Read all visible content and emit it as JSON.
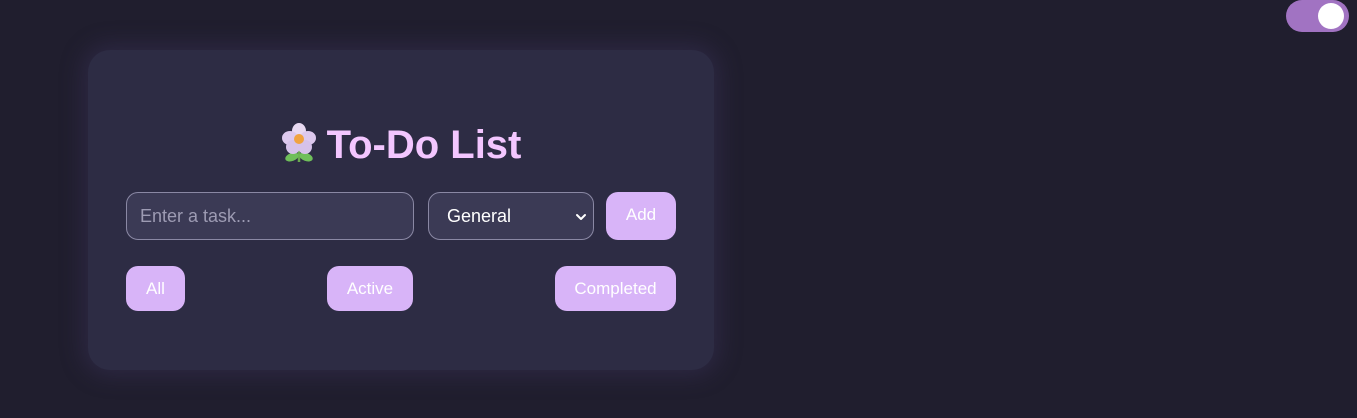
{
  "theme_toggle": {
    "state": "on",
    "color": "#a173c2"
  },
  "todo": {
    "title": "To-Do List",
    "title_icon": "flower-icon",
    "task_input": {
      "placeholder": "Enter a task...",
      "value": ""
    },
    "category_select": {
      "selected": "General"
    },
    "add_label": "Add",
    "filters": {
      "all": "All",
      "active": "Active",
      "completed": "Completed"
    }
  },
  "colors": {
    "background": "#201e2e",
    "card": "#2d2c44",
    "accent": "#d8b4f8",
    "title": "#f3c6ff"
  }
}
